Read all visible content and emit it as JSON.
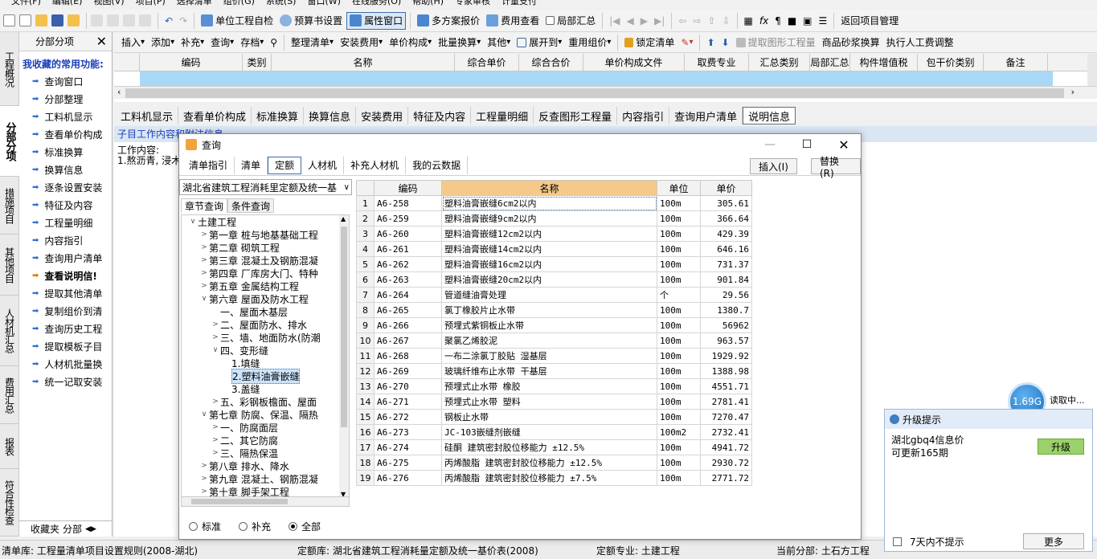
{
  "menu": [
    "文件(F)",
    "编辑(E)",
    "视图(V)",
    "项目(P)",
    "选择清单",
    "组价(G)",
    "系统(S)",
    "窗口(W)",
    "在线服务(O)",
    "帮助(H)",
    "专家审核",
    "计量支付"
  ],
  "toolbar1": {
    "unit_check": "单位工程自检",
    "budget_settings": "预算书设置",
    "property_window": "属性窗口",
    "multi_plan": "多方案报价",
    "fee_view": "费用查看",
    "partial_summary": "局部汇总",
    "return_project": "返回项目管理"
  },
  "toolbar2": {
    "insert": "插入",
    "add": "添加",
    "supplement": "补充",
    "query": "查询",
    "archive": "存档",
    "organize": "整理清单",
    "install_fee": "安装费用",
    "unit_price_comp": "单价构成",
    "batch_convert": "批量换算",
    "other": "其他",
    "expand_to": "展开到",
    "recompose": "重用组价",
    "lock_list": "锁定清单",
    "extract_qty": "提取图形工程量",
    "mortar_convert": "商品砂浆换算",
    "labor_adjust": "执行人工费调整"
  },
  "vtabs": [
    "工程概况",
    "分部分项",
    "措施项目",
    "其他项目",
    "人材机汇总",
    "费用汇总",
    "报表",
    "符合性检查"
  ],
  "left_panel": {
    "header": "分部分项",
    "title": "我收藏的常用功能:",
    "items": [
      "查询窗口",
      "分部整理",
      "工料机显示",
      "查看单价构成",
      "标准换算",
      "换算信息",
      "逐条设置安装",
      "特征及内容",
      "工程量明细",
      "内容指引",
      "查询用户清单",
      "查看说明信!",
      "提取其他清单",
      "复制组价到清",
      "查询历史工程",
      "提取模板子目",
      "人材机批量换",
      "统一记取安装"
    ],
    "footer_tabs": [
      "收藏夹",
      "分部"
    ]
  },
  "grid": {
    "columns": [
      "编码",
      "类别",
      "名称",
      "综合单价",
      "综合合价",
      "单价构成文件",
      "取费专业",
      "汇总类别",
      "局部汇总",
      "构件增值税",
      "包干价类别",
      "备注"
    ]
  },
  "subtabs": [
    "工料机显示",
    "查看单价构成",
    "标准换算",
    "换算信息",
    "安装费用",
    "特征及内容",
    "工程量明细",
    "反查图形工程量",
    "内容指引",
    "查询用户清单",
    "说明信息"
  ],
  "detail": {
    "title": "子目工作内容和附注信息",
    "line1": "工作内容:",
    "line2": "1.熬沥青, 浸木"
  },
  "dialog": {
    "title": "查询",
    "tabs": [
      "清单指引",
      "清单",
      "定额",
      "人材机",
      "补充人材机",
      "我的云数据"
    ],
    "insert_btn": "插入(I)",
    "replace_btn": "替换(R)",
    "library": "湖北省建筑工程消耗里定额及统一基",
    "tree_tabs": [
      "章节查询",
      "条件查询"
    ],
    "tree": [
      {
        "level": 0,
        "toggle": "∨",
        "label": "土建工程"
      },
      {
        "level": 1,
        "toggle": ">",
        "label": "第一章  桩与地基基础工程"
      },
      {
        "level": 1,
        "toggle": ">",
        "label": "第二章  砌筑工程"
      },
      {
        "level": 1,
        "toggle": ">",
        "label": "第三章  混凝土及钢筋混凝"
      },
      {
        "level": 1,
        "toggle": ">",
        "label": "第四章  厂库房大门、特种"
      },
      {
        "level": 1,
        "toggle": ">",
        "label": "第五章  金属结构工程"
      },
      {
        "level": 1,
        "toggle": "∨",
        "label": "第六章  屋面及防水工程"
      },
      {
        "level": 2,
        "toggle": "",
        "label": "一、屋面木基层"
      },
      {
        "level": 2,
        "toggle": ">",
        "label": "二、屋面防水、排水"
      },
      {
        "level": 2,
        "toggle": ">",
        "label": "三、墙、地面防水(防潮"
      },
      {
        "level": 2,
        "toggle": "∨",
        "label": "四、变形缝"
      },
      {
        "level": 3,
        "toggle": "",
        "label": "1.填缝"
      },
      {
        "level": 3,
        "toggle": "",
        "label": "2.塑料油膏嵌缝",
        "selected": true
      },
      {
        "level": 3,
        "toggle": "",
        "label": "3.盖缝"
      },
      {
        "level": 2,
        "toggle": ">",
        "label": "五、彩钢板檐面、屋面"
      },
      {
        "level": 1,
        "toggle": "∨",
        "label": "第七章  防腐、保温、隔热"
      },
      {
        "level": 2,
        "toggle": ">",
        "label": "一、防腐面层"
      },
      {
        "level": 2,
        "toggle": ">",
        "label": "二、其它防腐"
      },
      {
        "level": 2,
        "toggle": ">",
        "label": "三、隔热保温"
      },
      {
        "level": 1,
        "toggle": ">",
        "label": "第八章  排水、降水"
      },
      {
        "level": 1,
        "toggle": ">",
        "label": "第九章  混凝土、钢筋混凝"
      },
      {
        "level": 1,
        "toggle": ">",
        "label": "第十章  脚手架工程"
      }
    ],
    "radios": [
      {
        "label": "标准",
        "checked": false
      },
      {
        "label": "补充",
        "checked": false
      },
      {
        "label": "全部",
        "checked": true
      }
    ],
    "table_headers": [
      "编码",
      "名称",
      "单位",
      "单价"
    ],
    "rows": [
      {
        "idx": "1",
        "code": "A6-258",
        "name": "塑料油膏嵌缝6cm2以内",
        "unit": "100m",
        "price": "305.61"
      },
      {
        "idx": "2",
        "code": "A6-259",
        "name": "塑料油膏嵌缝9cm2以内",
        "unit": "100m",
        "price": "366.64"
      },
      {
        "idx": "3",
        "code": "A6-260",
        "name": "塑料油膏嵌缝12cm2以内",
        "unit": "100m",
        "price": "429.39"
      },
      {
        "idx": "4",
        "code": "A6-261",
        "name": "塑料油膏嵌缝14cm2以内",
        "unit": "100m",
        "price": "646.16"
      },
      {
        "idx": "5",
        "code": "A6-262",
        "name": "塑料油膏嵌缝16cm2以内",
        "unit": "100m",
        "price": "731.37"
      },
      {
        "idx": "6",
        "code": "A6-263",
        "name": "塑料油膏嵌缝20cm2以内",
        "unit": "100m",
        "price": "901.84"
      },
      {
        "idx": "7",
        "code": "A6-264",
        "name": "管道缝油膏处理",
        "unit": "个",
        "price": "29.56"
      },
      {
        "idx": "8",
        "code": "A6-265",
        "name": "氯丁橡胶片止水带",
        "unit": "100m",
        "price": "1380.7"
      },
      {
        "idx": "9",
        "code": "A6-266",
        "name": "预埋式紫铜板止水带",
        "unit": "100m",
        "price": "56962"
      },
      {
        "idx": "10",
        "code": "A6-267",
        "name": "聚氯乙烯胶泥",
        "unit": "100m",
        "price": "963.57"
      },
      {
        "idx": "11",
        "code": "A6-268",
        "name": "一布二涂氯丁胶贴 湿基层",
        "unit": "100m",
        "price": "1929.92"
      },
      {
        "idx": "12",
        "code": "A6-269",
        "name": "玻璃纤维布止水带 干基层",
        "unit": "100m",
        "price": "1388.98"
      },
      {
        "idx": "13",
        "code": "A6-270",
        "name": "预埋式止水带 橡胶",
        "unit": "100m",
        "price": "4551.71"
      },
      {
        "idx": "14",
        "code": "A6-271",
        "name": "预埋式止水带 塑料",
        "unit": "100m",
        "price": "2781.41"
      },
      {
        "idx": "15",
        "code": "A6-272",
        "name": "钢板止水带",
        "unit": "100m",
        "price": "7270.47"
      },
      {
        "idx": "16",
        "code": "A6-273",
        "name": "JC-103嵌缝剂嵌缝",
        "unit": "100m2",
        "price": "2732.41"
      },
      {
        "idx": "17",
        "code": "A6-274",
        "name": "硅酮 建筑密封胶位移能力 ±12.5%",
        "unit": "100m",
        "price": "4941.72"
      },
      {
        "idx": "18",
        "code": "A6-275",
        "name": "丙烯酸脂 建筑密封胶位移能力 ±12.5%",
        "unit": "100m",
        "price": "2930.72"
      },
      {
        "idx": "19",
        "code": "A6-276",
        "name": "丙烯酸脂 建筑密封胶位移能力 ±7.5%",
        "unit": "100m",
        "price": "2771.72"
      }
    ]
  },
  "upgrade": {
    "title": "升级提示",
    "line1": "湖北gbq4信息价",
    "line2": "可更新165期",
    "button": "升级",
    "checkbox": "7天内不提示",
    "more": "更多"
  },
  "speed": {
    "value": "1.69G",
    "label": "读取中..."
  },
  "status": {
    "list_lib": "清单库:  工程量清单项目设置规则(2008-湖北)",
    "quota_lib": "定额库:  湖北省建筑工程消耗量定额及统一基价表(2008)",
    "quota_major": "定额专业:  土建工程",
    "current_section": "当前分部:  土石方工程"
  },
  "colors": {
    "accent": "#3b6ea5",
    "selection": "#a8d8f5",
    "header_highlight": "#f5c98a",
    "upgrade_button": "#9bd16a"
  }
}
